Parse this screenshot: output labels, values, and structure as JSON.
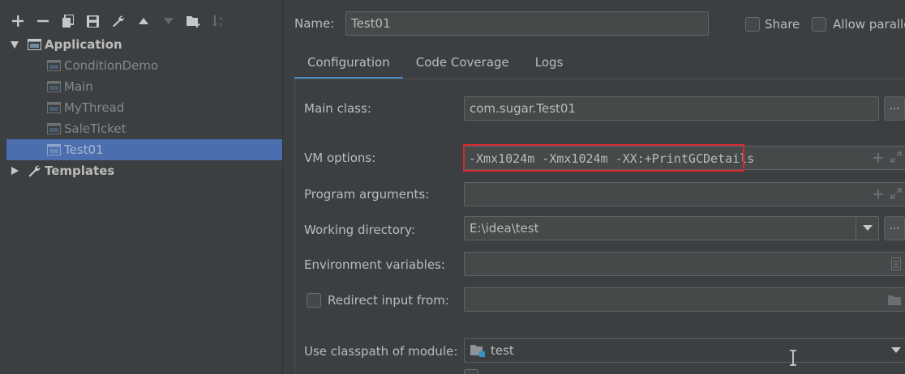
{
  "toolbar": {
    "icons": [
      "add-icon",
      "remove-icon",
      "copy-icon",
      "save-icon",
      "wrench-icon",
      "move-up-icon",
      "move-down-icon",
      "folder-add-icon",
      "sort-icon"
    ]
  },
  "tree": {
    "application": "Application",
    "children": [
      "ConditionDemo",
      "Main",
      "MyThread",
      "SaleTicket",
      "Test01"
    ],
    "selected": "Test01",
    "templates": "Templates"
  },
  "header": {
    "name_label": "Name:",
    "name_value": "Test01",
    "share_label": "Share",
    "allow_parallel_label": "Allow paralle"
  },
  "tabs": [
    "Configuration",
    "Code Coverage",
    "Logs"
  ],
  "form": {
    "main_class_label": "Main class:",
    "main_class_value": "com.sugar.Test01",
    "vm_options_label": "VM options:",
    "vm_options_value": "-Xmx1024m -Xmx1024m -XX:+PrintGCDetails",
    "program_args_label": "Program arguments:",
    "program_args_value": "",
    "working_dir_label": "Working directory:",
    "working_dir_value": "E:\\idea\\test",
    "env_vars_label": "Environment variables:",
    "env_vars_value": "",
    "redirect_label": "Redirect input from:",
    "redirect_value": "",
    "classpath_label": "Use classpath of module:",
    "classpath_value": "test",
    "browse_label": "..."
  },
  "colors": {
    "background": "#3c3f41",
    "selection": "#4b6eaf",
    "highlight_box": "#d4292f",
    "tab_underline": "#4a88c7"
  }
}
